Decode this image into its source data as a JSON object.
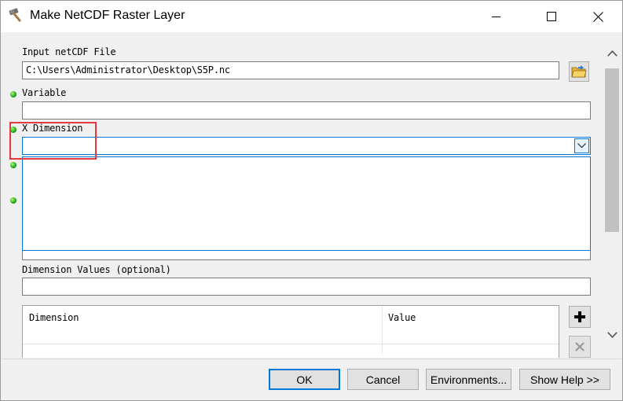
{
  "window": {
    "title": "Make NetCDF Raster Layer",
    "title_icon": "hammer-icon",
    "controls": {
      "minimize": "minimize-icon",
      "maximize": "maximize-icon",
      "close": "close-icon"
    }
  },
  "form": {
    "input_file": {
      "label": "Input netCDF File",
      "value": "C:\\Users\\Administrator\\Desktop\\S5P.nc",
      "browse_icon": "open-folder-icon"
    },
    "variable": {
      "label": "Variable",
      "value": ""
    },
    "x_dimension": {
      "label": "X Dimension",
      "value": ""
    },
    "dimension_values": {
      "label": "Dimension Values (optional)",
      "value": ""
    },
    "table": {
      "columns": [
        "Dimension",
        "Value"
      ],
      "add_icon": "plus-icon",
      "remove_icon": "x-icon"
    }
  },
  "colors": {
    "accent": "#0078d7",
    "required_dot": "#1fa31f",
    "highlight": "#e6393f"
  },
  "buttons": {
    "ok": "OK",
    "cancel": "Cancel",
    "environments": "Environments...",
    "show_help": "Show Help >>"
  }
}
